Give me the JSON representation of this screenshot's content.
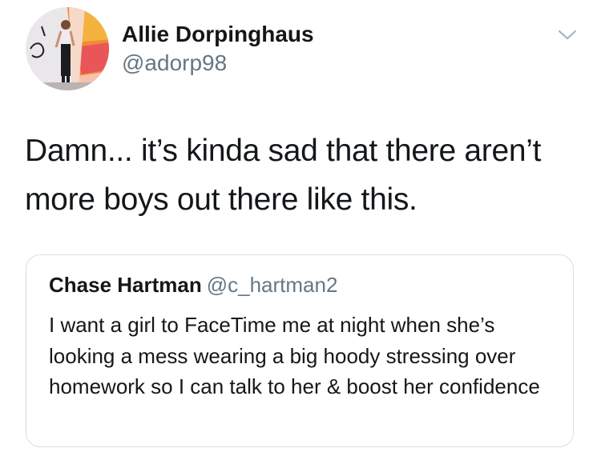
{
  "tweet": {
    "author": {
      "display_name": "Allie Dorpinghaus",
      "handle": "@adorp98"
    },
    "text": "Damn... it’s kinda sad that there aren’t more boys out there like this.",
    "menu_icon": "chevron-down-icon",
    "quoted_tweet": {
      "display_name": "Chase Hartman",
      "handle": "@c_hartman2",
      "text": "I want a girl to FaceTime me at night when she’s looking a mess wearing a big hoody stressing over homework so I can talk to her & boost her confidence"
    }
  },
  "colors": {
    "primary_text": "#14171a",
    "secondary_text": "#657786",
    "border": "#d8dee2"
  }
}
